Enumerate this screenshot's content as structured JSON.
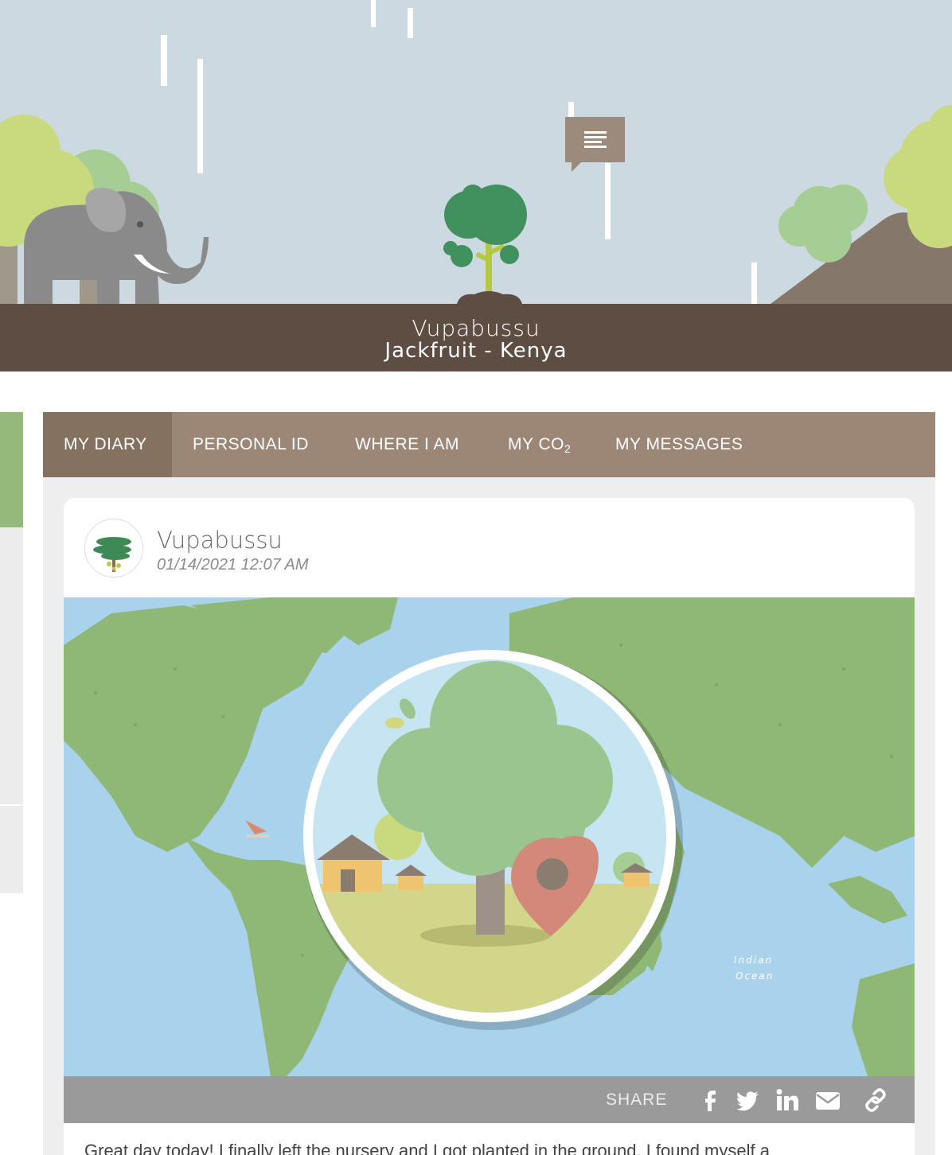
{
  "hero": {
    "name": "Vupabussu",
    "subtitle": "Jackfruit - Kenya",
    "sky_color": "#ccd9e1",
    "ground_bar_color": "#5d4d43"
  },
  "tabs": [
    {
      "label": "MY DIARY",
      "active": true
    },
    {
      "label": "PERSONAL ID",
      "active": false
    },
    {
      "label": "WHERE I AM",
      "active": false
    },
    {
      "label_main": "MY CO",
      "label_sub": "2",
      "active": false
    },
    {
      "label": "MY MESSAGES",
      "active": false
    }
  ],
  "post": {
    "author": "Vupabussu",
    "date": "01/14/2021 12:07 AM",
    "map_labels": {
      "ocean": "Indian",
      "ocean2": "Ocean"
    },
    "share_label": "SHARE",
    "share_icons": [
      "facebook-icon",
      "twitter-icon",
      "linkedin-icon",
      "email-icon",
      "link-icon"
    ],
    "body_preview": "Great day today! I finally left the nursery and I got planted in the ground. I found myself a"
  },
  "colors": {
    "tab_bg": "#9c8777",
    "tab_active": "#85715f",
    "share_bar": "#9a9a9a",
    "accent_green": "#95b97b"
  }
}
